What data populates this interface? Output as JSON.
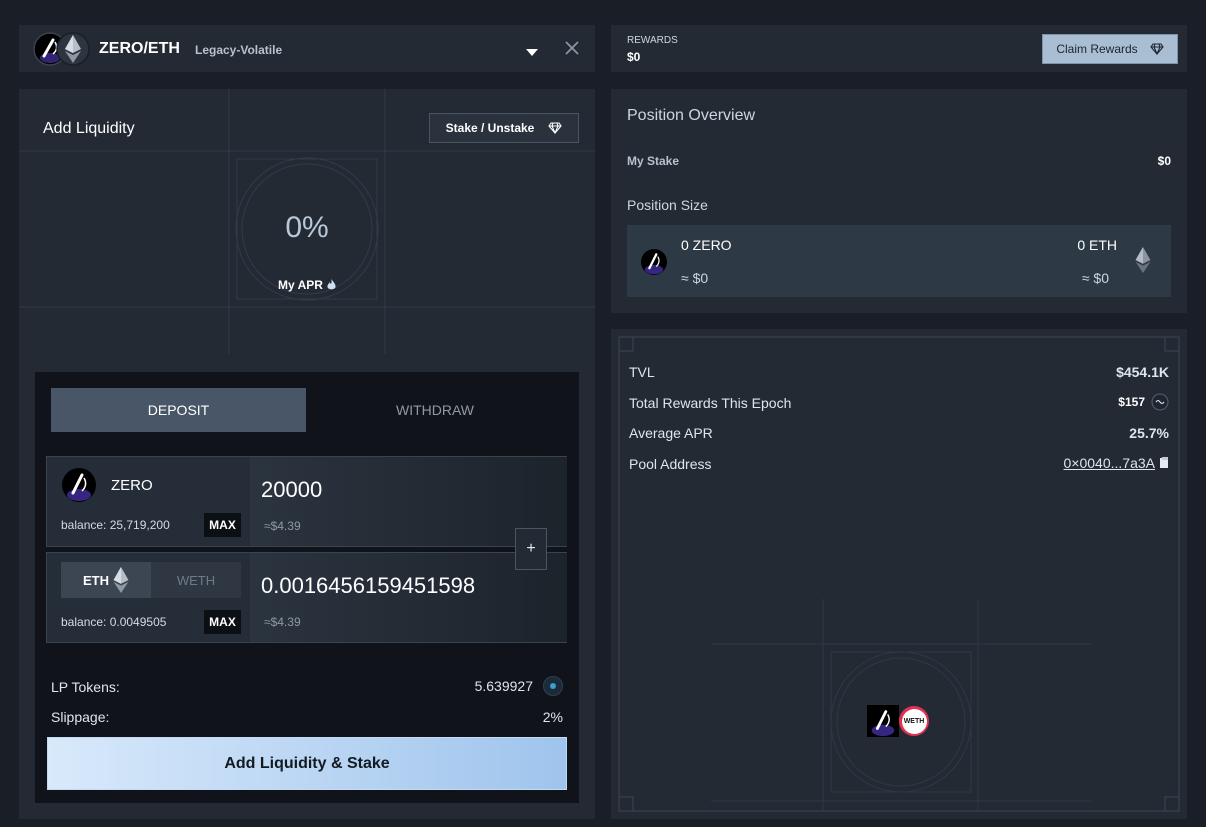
{
  "header": {
    "pair": "ZERO/ETH",
    "pool_type": "Legacy-Volatile"
  },
  "rewards_bar": {
    "label": "REWARDS",
    "value": "$0",
    "claim_label": "Claim Rewards"
  },
  "add_liquidity": {
    "title": "Add Liquidity",
    "stake_label": "Stake / Unstake",
    "apr_value": "0%",
    "apr_label": "My APR"
  },
  "tabs": {
    "deposit": "DEPOSIT",
    "withdraw": "WITHDRAW",
    "active": "DEPOSIT"
  },
  "zero_input": {
    "token": "ZERO",
    "balance": "balance: 25,719,200",
    "max_label": "MAX",
    "amount": "20000",
    "usd": "≈$4.39"
  },
  "eth_input": {
    "option_eth": "ETH",
    "option_weth": "WETH",
    "selected": "ETH",
    "balance": "balance: 0.0049505",
    "max_label": "MAX",
    "amount": "0.0016456159451598",
    "usd": "≈$4.39"
  },
  "plus_label": "+",
  "summary": {
    "lp_label": "LP Tokens:",
    "lp_value": "5.639927",
    "slippage_label": "Slippage:",
    "slippage_value": "2%"
  },
  "submit_label": "Add Liquidity & Stake",
  "position": {
    "title": "Position Overview",
    "my_stake_label": "My Stake",
    "my_stake_value": "$0",
    "size_label": "Position Size",
    "zero_amount": "0 ZERO",
    "zero_usd": "≈ $0",
    "eth_amount": "0 ETH",
    "eth_usd": "≈ $0"
  },
  "pool_stats": {
    "tvl_label": "TVL",
    "tvl_value": "$454.1K",
    "rewards_label": "Total Rewards This Epoch",
    "rewards_value": "$157",
    "apr_label": "Average APR",
    "apr_value": "25.7%",
    "address_label": "Pool Address",
    "address_value": "0×0040...7a3A",
    "weth_badge": "WETH"
  },
  "icons": {
    "zero_logo": "zero-token-icon",
    "eth_logo": "eth-diamond-icon",
    "dropdown": "chevron-down-icon",
    "close": "close-icon",
    "gem": "gem-icon",
    "fire": "fire-icon",
    "copy": "copy-icon",
    "lp": "lp-token-icon"
  },
  "colors": {
    "background": "#1a1f27",
    "panel": "#232a34",
    "inner_panel": "#10141a",
    "submit_gradient_start": "#d8e9fb",
    "submit_gradient_end": "#9fc4ec",
    "claim_button": "#a9bed2"
  }
}
